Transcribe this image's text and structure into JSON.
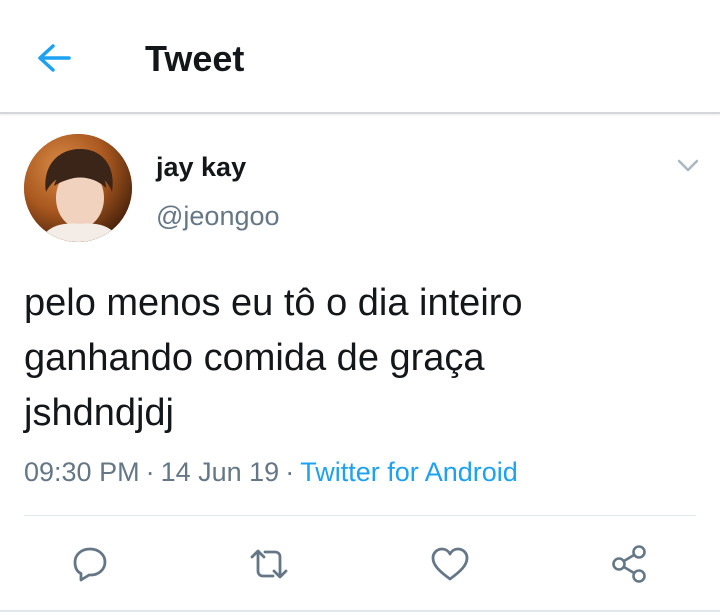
{
  "header": {
    "title": "Tweet",
    "back_icon": "arrow-left-icon"
  },
  "tweet": {
    "author": {
      "display_name": "jay kay",
      "handle": "@jeongoo"
    },
    "text": "pelo menos eu tô o dia inteiro\nganhando comida de graça\njshdndjdj",
    "time": "09:30 PM",
    "separator": "·",
    "date": "14 Jun 19",
    "source": "Twitter for Android"
  },
  "actions": [
    {
      "name": "reply",
      "icon": "reply-icon"
    },
    {
      "name": "retweet",
      "icon": "retweet-icon"
    },
    {
      "name": "like",
      "icon": "heart-icon"
    },
    {
      "name": "share",
      "icon": "share-icon"
    }
  ],
  "colors": {
    "accent": "#1da1f2",
    "text_primary": "#14171a",
    "text_secondary": "#657786",
    "icon_gray": "#657786",
    "divider": "#e1e8ed"
  }
}
